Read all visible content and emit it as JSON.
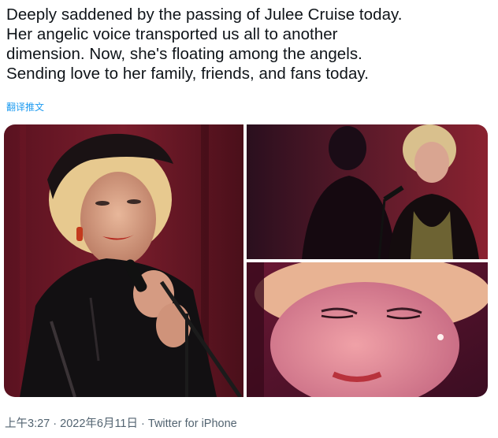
{
  "tweet": {
    "lines": [
      "Deeply saddened by the passing of Julee Cruise today.",
      "Her angelic voice transported us all to another",
      "dimension. Now, she's floating among the angels.",
      "Sending love to her family, friends, and fans today."
    ],
    "translate_label": "翻译推文"
  },
  "media": {
    "photos": [
      {
        "alt": "photo-1"
      },
      {
        "alt": "photo-2"
      },
      {
        "alt": "photo-3"
      }
    ]
  },
  "meta": {
    "time": "上午3:27",
    "separator": " · ",
    "date": "2022年6月11日",
    "source": "Twitter for iPhone"
  },
  "colors": {
    "text": "#0f1419",
    "link": "#1d9bf0",
    "meta": "#536471"
  }
}
